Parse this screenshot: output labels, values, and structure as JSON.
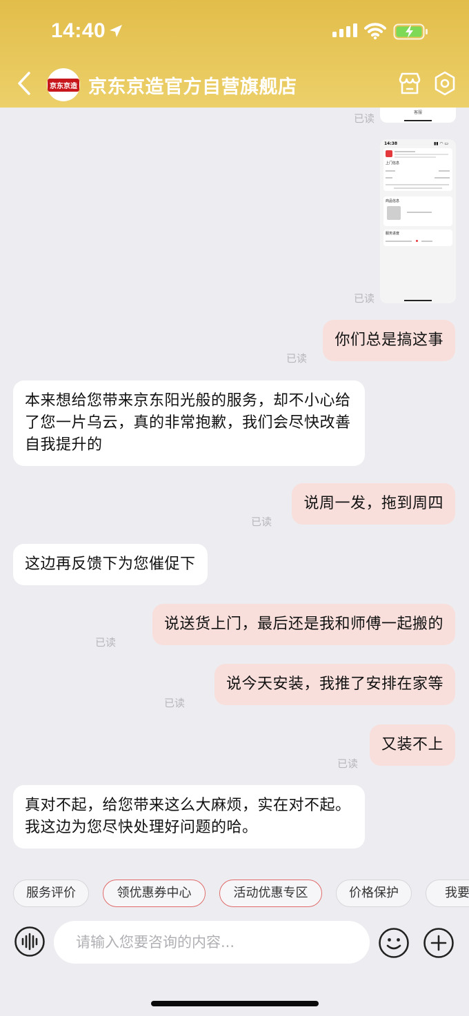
{
  "status_bar": {
    "time": "14:40"
  },
  "header": {
    "title": "京东京造官方自营旗舰店",
    "avatar_text": "京东京造"
  },
  "read_label": "已读",
  "screenshot_preview": {
    "tab_label": "客服",
    "time": "14:38",
    "section_1": "上门信息",
    "section_2": "商品信息",
    "section_3": "服务进度"
  },
  "messages": [
    {
      "side": "out",
      "text": "你们总是搞这事"
    },
    {
      "side": "in",
      "text": "本来想给您带来京东阳光般的服务，却不小心给了您一片乌云，真的非常抱歉，我们会尽快改善自我提升的"
    },
    {
      "side": "out",
      "text": "说周一发，拖到周四"
    },
    {
      "side": "in",
      "text": "这边再反馈下为您催促下"
    },
    {
      "side": "out",
      "text": "说送货上门，最后还是我和师傅一起搬的"
    },
    {
      "side": "out",
      "text": "说今天安装，我推了安排在家等"
    },
    {
      "side": "out",
      "text": "又装不上"
    },
    {
      "side": "in",
      "text": "真对不起，给您带来这么大麻烦，实在对不起。我这边为您尽快处理好问题的哈。"
    }
  ],
  "quick_actions": [
    "服务评价",
    "领优惠券中心",
    "活动优惠专区",
    "价格保护",
    "我要催"
  ],
  "input": {
    "placeholder": "请输入您要咨询的内容..."
  },
  "colors": {
    "header_bg": "#e6c455",
    "outgoing_bubble": "#f8dfdb",
    "incoming_bubble": "#ffffff",
    "chat_bg": "#ededf1",
    "promo_chip_border": "#e06a6a"
  }
}
